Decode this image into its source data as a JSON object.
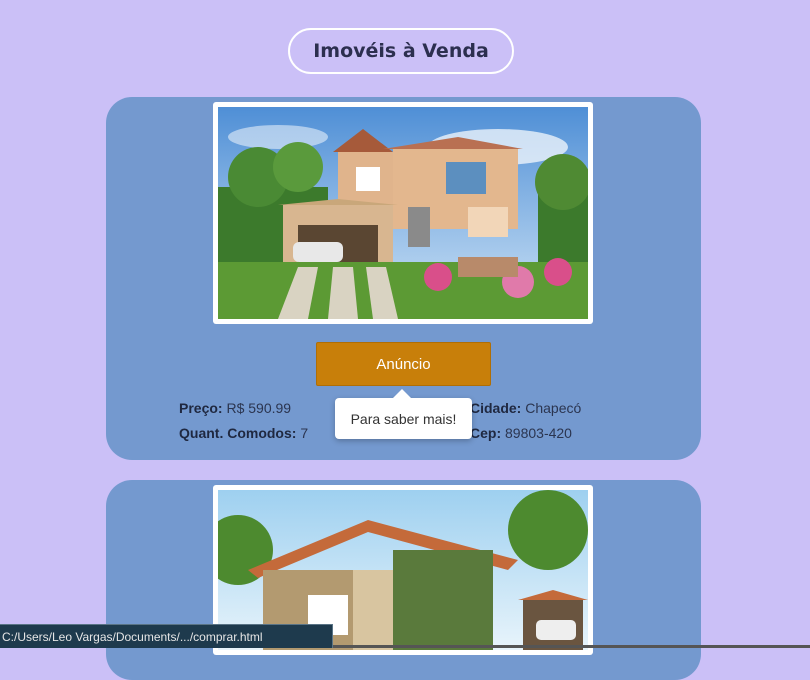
{
  "header": {
    "title": "Imovéis à Venda"
  },
  "listings": [
    {
      "button_label": "Anúncio",
      "price_label": "Preço:",
      "price_value": "R$ 590.99",
      "rooms_label": "Quant. Comodos:",
      "rooms_value": "7",
      "city_label": "Cidade:",
      "city_value": "Chapecó",
      "cep_label": "Cep:",
      "cep_value": "89803-420"
    }
  ],
  "tooltip": {
    "text": "Para saber mais!"
  },
  "statusbar": {
    "url": "C:/Users/Leo Vargas/Documents/.../comprar.html"
  },
  "colors": {
    "background": "#cbc0f7",
    "card": "#7499cf",
    "button": "#c87f0a"
  }
}
